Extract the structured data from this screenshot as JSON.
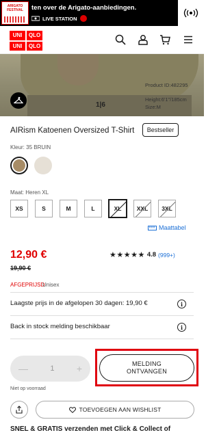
{
  "banner": {
    "logo_text": "ARIGATO FESTIVAL",
    "text": "ten over de Arigato-aanbiedingen.",
    "live_label": "LIVE STATION"
  },
  "header": {
    "logo": [
      "UNI",
      "QLO",
      "UNI",
      "QLO"
    ],
    "icons": [
      "search-icon",
      "account-icon",
      "cart-icon",
      "menu-icon"
    ]
  },
  "hero": {
    "counter": "1|6",
    "product_id": "Product ID:482295",
    "height": "Height:6'1\"/185cm",
    "size": "Size:M"
  },
  "product": {
    "title": "AIRism Katoenen Oversized T-Shirt",
    "badge": "Bestseller",
    "color_label": "Kleur: 35 BRUIN",
    "colors": [
      {
        "name": "BRUIN",
        "hex": "#a78c66",
        "selected": true
      },
      {
        "name": "BEIGE",
        "hex": "#e6e0d6",
        "selected": false
      }
    ],
    "size_label": "Maat: Heren XL",
    "sizes": [
      {
        "label": "XS",
        "available": true
      },
      {
        "label": "S",
        "available": true
      },
      {
        "label": "M",
        "available": true
      },
      {
        "label": "L",
        "available": true
      },
      {
        "label": "XL",
        "available": false,
        "selected": true
      },
      {
        "label": "XXL",
        "available": false
      },
      {
        "label": "3XL",
        "available": false
      }
    ],
    "size_table_link": "Maattabel"
  },
  "pricing": {
    "price": "12,90 €",
    "old_price": "19,90 €",
    "stars": "★★★★★",
    "rating": "4.8",
    "review_count": "(999+)",
    "tag_sale": "AFGEPRIJSD",
    "tag_gender": "Unisex"
  },
  "info": {
    "lowest_price": "Laagste prijs in de afgelopen 30 dagen: 19,90 €",
    "back_in_stock": "Back in stock melding beschikbaar"
  },
  "purchase": {
    "qty_minus": "—",
    "qty_value": "1",
    "qty_plus": "+",
    "cta_line1": "MELDING",
    "cta_line2": "ONTVANGEN",
    "stock_note": "Niet op voorraad",
    "wishlist": "TOEVOEGEN AAN WISHLIST",
    "shipping": "SNEL & GRATIS verzenden met Click & Collect of"
  },
  "colors": {
    "brand_red": "#ff0000",
    "sale_red": "#e00000",
    "link_blue": "#1b6fd6"
  }
}
